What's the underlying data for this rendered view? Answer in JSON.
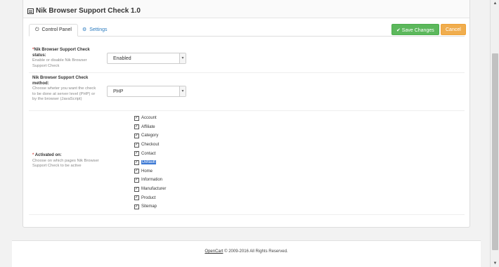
{
  "header": {
    "title": "Nik Browser Support Check 1.0"
  },
  "tabs": [
    {
      "label": "Control Panel",
      "icon": "power-icon"
    },
    {
      "label": "Settings",
      "icon": "gears-icon"
    }
  ],
  "actions": {
    "save_label": "✔ Save Changes",
    "cancel_label": "Cancel"
  },
  "form": {
    "status": {
      "required_mark": "*",
      "title": "Nik Browser Support Check status:",
      "help": "Enable or disable Nik Browser Support Check",
      "value": "Enabled"
    },
    "method": {
      "title": "Nik Browser Support Check method:",
      "help": "Choose wheter you want the check to be done at server level (PHP) or by the browser (JavaScript)",
      "value": "PHP"
    },
    "activated": {
      "required_mark": "*",
      "title": "Activated on:",
      "help": "Choose on which pages Nik Browser Support Check to be active",
      "pages": [
        {
          "label": "Account",
          "checked": true
        },
        {
          "label": "Affiliate",
          "checked": true
        },
        {
          "label": "Category",
          "checked": true
        },
        {
          "label": "Checkout",
          "checked": true
        },
        {
          "label": "Contact",
          "checked": true
        },
        {
          "label": "Default",
          "checked": true
        },
        {
          "label": "Home",
          "checked": true
        },
        {
          "label": "Information",
          "checked": true
        },
        {
          "label": "Manufacturer",
          "checked": true
        },
        {
          "label": "Product",
          "checked": true
        },
        {
          "label": "Sitemap",
          "checked": true
        }
      ]
    }
  },
  "footer": {
    "link": "OpenCart",
    "text": " © 2009-2016 All Rights Reserved."
  },
  "colors": {
    "save": "#5cb85c",
    "cancel": "#f0ad4e",
    "link": "#2a7bbf",
    "selection": "#3b78d4"
  }
}
